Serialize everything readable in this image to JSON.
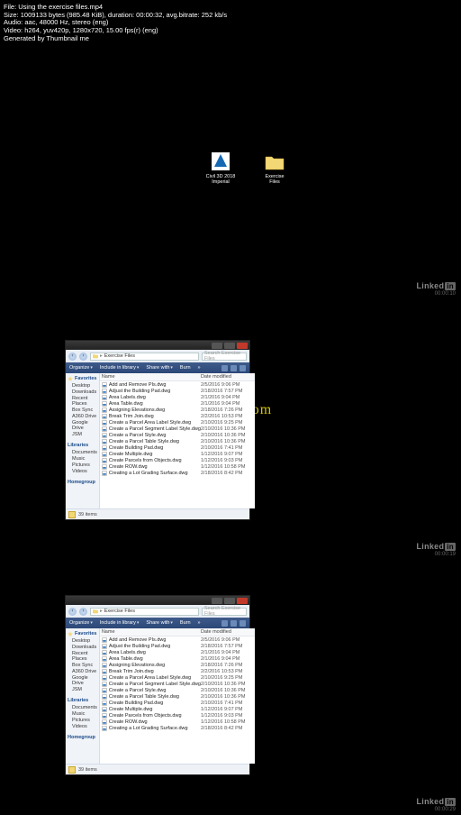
{
  "info": {
    "file": "File: Using the exercise files.mp4",
    "size": "Size: 1009133 bytes (985.48 KiB), duration: 00:00:32, avg.bitrate: 252 kb/s",
    "audio": "Audio: aac, 48000 Hz, stereo (eng)",
    "video": "Video: h264, yuv420p, 1280x720, 15.00 fps(r) (eng)",
    "generated": "Generated by Thumbnail me"
  },
  "desktop": {
    "icons": [
      {
        "label": "Civil 3D 2018 Imperial"
      },
      {
        "label": "Exercise Files"
      }
    ]
  },
  "watermark": "www.    ku.com",
  "linkedin": {
    "brand_a": "Linked",
    "brand_b": "in",
    "ts": [
      "00:00:10",
      "00:00:19",
      "00:00:29"
    ]
  },
  "explorer": {
    "path_label": "Exercise Files",
    "search_placeholder": "Search Exercise Files",
    "toolbar": {
      "organize": "Organize",
      "include": "Include in library",
      "share": "Share with",
      "burn": "Burn",
      "more": "»"
    },
    "sidebar": {
      "favorites": {
        "head": "Favorites",
        "items": [
          "Desktop",
          "Downloads",
          "Recent Places",
          "Box Sync",
          "A360 Drive",
          "Google Drive",
          "JSM"
        ]
      },
      "libraries": {
        "head": "Libraries",
        "items": [
          "Documents",
          "Music",
          "Pictures",
          "Videos"
        ]
      },
      "homegroup": {
        "head": "Homegroup"
      }
    },
    "columns": {
      "name": "Name",
      "date": "Date modified"
    },
    "files": [
      {
        "name": "Add and Remove PIs.dwg",
        "date": "2/5/2016 9:06 PM"
      },
      {
        "name": "Adjust the Building Pad.dwg",
        "date": "2/18/2016 7:57 PM"
      },
      {
        "name": "Area Labels.dwg",
        "date": "2/1/2016 9:04 PM"
      },
      {
        "name": "Area Table.dwg",
        "date": "2/1/2016 9:04 PM"
      },
      {
        "name": "Assigning Elevations.dwg",
        "date": "2/18/2016 7:26 PM"
      },
      {
        "name": "Break Trim Join.dwg",
        "date": "2/2/2016 10:53 PM"
      },
      {
        "name": "Create a Parcel Area Label Style.dwg",
        "date": "2/10/2016 9:25 PM"
      },
      {
        "name": "Create a Parcel Segment Label Style.dwg",
        "date": "2/10/2016 10:36 PM"
      },
      {
        "name": "Create a Parcel Style.dwg",
        "date": "2/10/2016 10:36 PM"
      },
      {
        "name": "Create a Parcel Table Style.dwg",
        "date": "2/10/2016 10:36 PM"
      },
      {
        "name": "Create Building Pad.dwg",
        "date": "2/10/2016 7:41 PM"
      },
      {
        "name": "Create Multiple.dwg",
        "date": "1/12/2016 9:07 PM"
      },
      {
        "name": "Create Parcels from Objects.dwg",
        "date": "1/12/2016 9:03 PM"
      },
      {
        "name": "Create ROW.dwg",
        "date": "1/12/2016 10:58 PM"
      },
      {
        "name": "Creating a Lot Grading Surface.dwg",
        "date": "2/18/2016 8:42 PM"
      }
    ],
    "status": "39 items"
  }
}
